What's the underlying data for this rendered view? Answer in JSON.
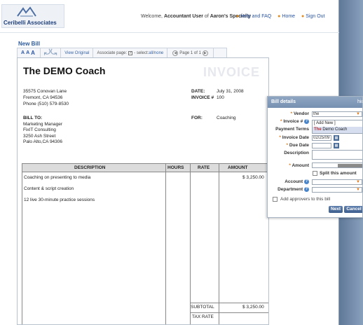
{
  "header": {
    "logo_text": "Ceribelli Associates",
    "welcome_prefix": "Welcome,",
    "welcome_user": "Accountant User",
    "welcome_mid": "of",
    "welcome_company": "Aaron's Specialty",
    "nav": [
      {
        "label": "Help and FAQ"
      },
      {
        "label": "Home"
      },
      {
        "label": "Sign Out"
      }
    ]
  },
  "page_title": "New Bill",
  "toolbar": {
    "size_small": "A",
    "size_medium": "A",
    "size_large": "A",
    "view_original": "View Original",
    "associate_page": "Associate page:",
    "select_label": "- select:",
    "select_all": "all",
    "select_sep": "/",
    "select_none": "none",
    "page_label": "Page 1 of 1"
  },
  "invoice": {
    "company": "The DEMO Coach",
    "watermark": "INVOICE",
    "address": [
      "35575 Conovan Lane",
      "Fremont, CA  94536",
      "Phone (510) 579-8530"
    ],
    "date_label": "DATE:",
    "date_value": "July 31, 2008",
    "number_label": "INVOICE #",
    "number_value": "100",
    "bill_to_label": "BILL TO:",
    "bill_to": [
      "Marketing Manager",
      "FixIT Consulting",
      "3250 Ash Street",
      "Palo Alto,CA  94306"
    ],
    "for_label": "FOR:",
    "for_value": "Coaching",
    "columns": [
      "DESCRIPTION",
      "HOURS",
      "RATE",
      "AMOUNT"
    ],
    "items": [
      "Coaching on presenting to media",
      "Content & script creation",
      "12 live 30-minute practice sessions"
    ],
    "amount": "$ 3,250.00",
    "subtotal_label": "SUBTOTAL",
    "subtotal_value": "$ 3,250.00",
    "tax_label": "TAX RATE"
  },
  "bill_panel": {
    "title": "Bill details",
    "hide_link": "hid",
    "vendor_label": "Vendor",
    "vendor_value": "the",
    "invoice_label": "Invoice #",
    "vendor_options": [
      "[ Add New ]"
    ],
    "vendor_option_match": "The",
    "vendor_option_rest": " Demo Coach",
    "payment_terms_label": "Payment Terms",
    "invoice_date_label": "Invoice Date",
    "invoice_date_value": "02/25/09",
    "due_date_label": "Due Date",
    "description_label": "Description",
    "amount_label": "Amount",
    "split_label": "Split this amount",
    "account_label": "Account",
    "department_label": "Department",
    "approvers_label": "Add approvers to this bill",
    "next_label": "Next",
    "cancel_label": "Cancel"
  },
  "colors": {
    "accent": "#2a55a6",
    "orange": "#e38a1a",
    "panel_header": "#7f98b8"
  }
}
